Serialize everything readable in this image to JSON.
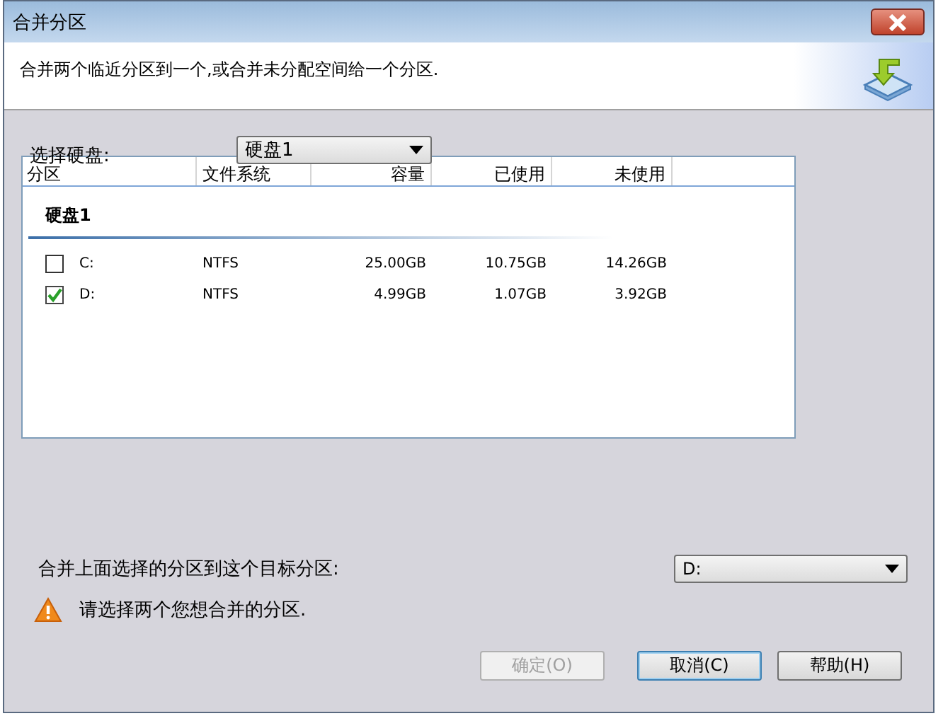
{
  "window": {
    "title": "合并分区"
  },
  "description": "合并两个临近分区到一个,或合并未分配空间给一个分区.",
  "disk_select": {
    "label": "选择硬盘:",
    "value": "硬盘1"
  },
  "table": {
    "columns": [
      "分区",
      "文件系统",
      "容量",
      "已使用",
      "未使用"
    ],
    "groups": [
      {
        "name": "硬盘1",
        "rows": [
          {
            "partition": "C:",
            "checked": false,
            "cells": [
              "NTFS",
              "25.00GB",
              "10.75GB",
              "14.26GB"
            ]
          },
          {
            "partition": "D:",
            "checked": true,
            "cells": [
              "NTFS",
              "4.99GB",
              "1.07GB",
              "3.92GB"
            ]
          }
        ]
      }
    ]
  },
  "target": {
    "label": "合并上面选择的分区到这个目标分区:",
    "value": "D:"
  },
  "warning": "请选择两个您想合并的分区.",
  "buttons": [
    {
      "label": "确定(O)",
      "disabled": true,
      "focused": false
    },
    {
      "label": "取消(C)",
      "disabled": false,
      "focused": true
    },
    {
      "label": "帮助(H)",
      "disabled": false,
      "focused": false
    }
  ]
}
